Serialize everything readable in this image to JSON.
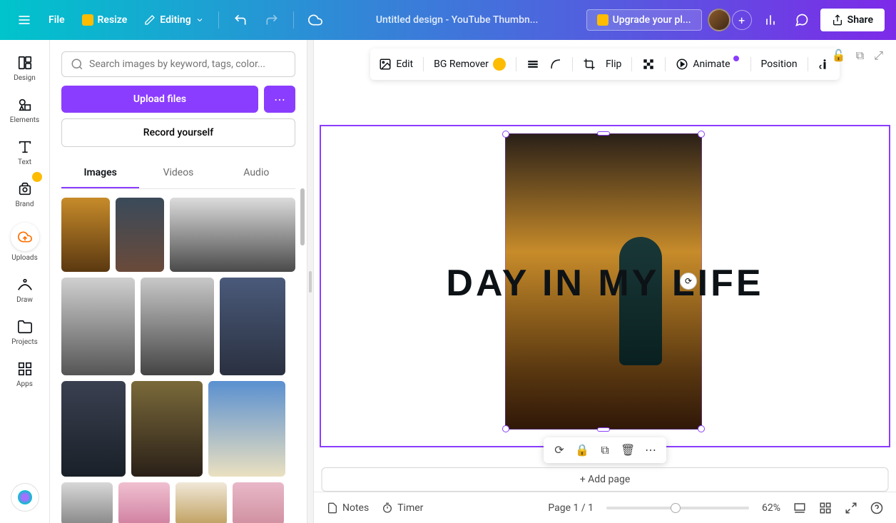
{
  "topbar": {
    "file": "File",
    "resize": "Resize",
    "editing": "Editing",
    "doc_title": "Untitled design - YouTube Thumbn...",
    "upgrade": "Upgrade your pl...",
    "share": "Share"
  },
  "rail": {
    "design": "Design",
    "elements": "Elements",
    "text": "Text",
    "brand": "Brand",
    "uploads": "Uploads",
    "draw": "Draw",
    "projects": "Projects",
    "apps": "Apps"
  },
  "panel": {
    "search_placeholder": "Search images by keyword, tags, color...",
    "upload": "Upload files",
    "record": "Record yourself",
    "tabs": {
      "images": "Images",
      "videos": "Videos",
      "audio": "Audio"
    }
  },
  "context": {
    "edit": "Edit",
    "bg_remover": "BG Remover",
    "flip": "Flip",
    "animate": "Animate",
    "position": "Position"
  },
  "canvas": {
    "text": "DAY IN   MY LIFE",
    "add_page": "+ Add page"
  },
  "footer": {
    "notes": "Notes",
    "timer": "Timer",
    "page_label": "Page 1 / 1",
    "zoom": "62%"
  }
}
